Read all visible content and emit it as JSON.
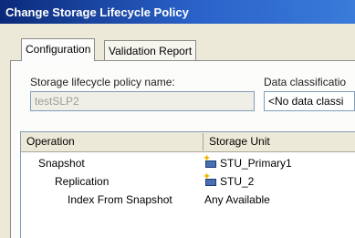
{
  "window": {
    "title": "Change Storage Lifecycle Policy"
  },
  "tabs": [
    {
      "label": "Configuration",
      "active": true
    },
    {
      "label": "Validation Report",
      "active": false
    }
  ],
  "form": {
    "name_label": "Storage lifecycle policy name:",
    "name_value": "testSLP2",
    "classification_label": "Data classificatio",
    "classification_value": "<No data classi"
  },
  "grid": {
    "columns": [
      "Operation",
      "Storage Unit"
    ],
    "rows": [
      {
        "operation": "Snapshot",
        "storage_unit": "STU_Primary1",
        "icon": "storage-unit-icon"
      },
      {
        "operation": "Replication",
        "storage_unit": "STU_2",
        "icon": "storage-unit-icon"
      },
      {
        "operation": "Index From Snapshot",
        "storage_unit": "Any Available",
        "icon": ""
      }
    ]
  },
  "colors": {
    "titlebar": "#0b2a7a",
    "dialog_bg": "#ece9d8",
    "field_border": "#7f9db9",
    "icon_star": "#f2b400"
  }
}
